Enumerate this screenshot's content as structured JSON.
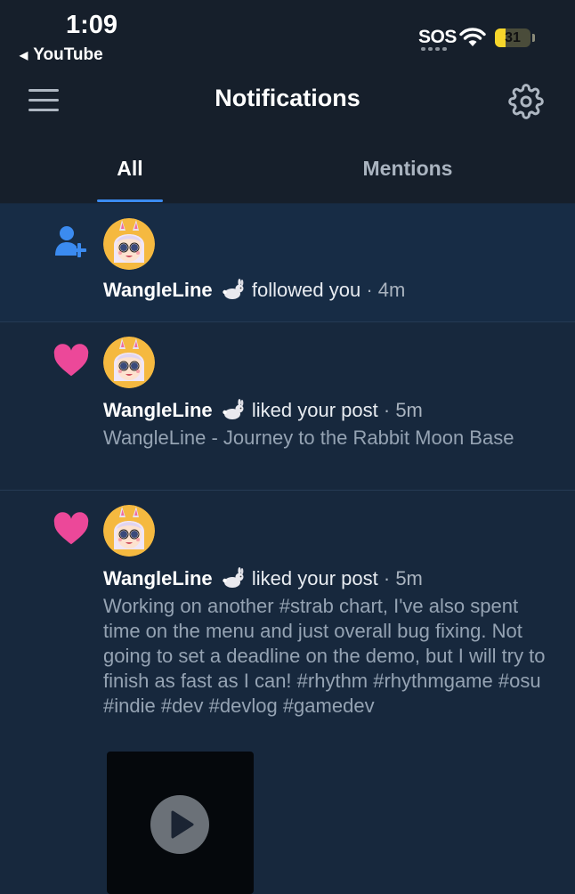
{
  "status_bar": {
    "time": "1:09",
    "back_app": "YouTube",
    "sos": "SOS",
    "battery": "31",
    "battery_level": 0.31
  },
  "header": {
    "title": "Notifications",
    "menu_icon": "hamburger-menu-icon",
    "settings_icon": "gear-icon"
  },
  "tabs": [
    {
      "label": "All",
      "active": true
    },
    {
      "label": "Mentions",
      "active": false
    }
  ],
  "notifications": [
    {
      "type_icon": "person-add-icon",
      "user": "WangleLine",
      "action": "followed you",
      "time": "· 4m"
    },
    {
      "type_icon": "heart-icon",
      "user": "WangleLine",
      "action": "liked your post",
      "time": "· 5m",
      "post_text": "WangleLine - Journey to the Rabbit Moon Base"
    },
    {
      "type_icon": "heart-icon",
      "user": "WangleLine",
      "action": "liked your post",
      "time": "· 5m",
      "post_text": "Working on another #strab chart, I've also spent time on the menu and just overall bug fixing. Not going to set a deadline on the demo, but I will try to finish as fast as I can! #rhythm #rhythmgame #osu #indie #dev #devlog #gamedev",
      "media": "video-thumbnail"
    }
  ],
  "colors": {
    "header_bg": "#161f2b",
    "body_bg": "#17283d",
    "accent": "#3b8bf0",
    "heart": "#ec4899",
    "muted_text": "#95a3b3"
  }
}
